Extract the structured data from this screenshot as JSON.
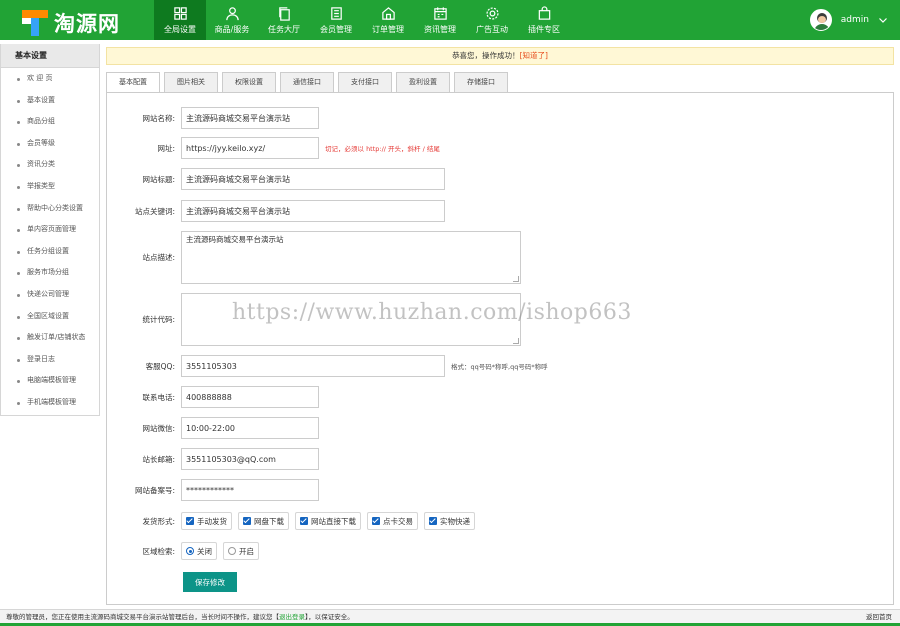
{
  "brand": {
    "logo_text": "淘源网"
  },
  "nav": [
    {
      "label": "全局设置",
      "icon": "grid-icon",
      "active": true
    },
    {
      "label": "商品/服务",
      "icon": "user-icon"
    },
    {
      "label": "任务大厅",
      "icon": "copy-icon"
    },
    {
      "label": "会员管理",
      "icon": "document-icon"
    },
    {
      "label": "订单管理",
      "icon": "home-icon"
    },
    {
      "label": "资讯管理",
      "icon": "calendar-icon"
    },
    {
      "label": "广告互动",
      "icon": "gear-icon"
    },
    {
      "label": "插件专区",
      "icon": "bag-icon"
    }
  ],
  "user": {
    "name": "admin"
  },
  "sidebar": {
    "title": "基本设置",
    "items": [
      {
        "label": "欢 迎 页"
      },
      {
        "label": "基本设置"
      },
      {
        "label": "商品分组"
      },
      {
        "label": "会员等级"
      },
      {
        "label": "资讯分类"
      },
      {
        "label": "举报类型"
      },
      {
        "label": "帮助中心分类设置"
      },
      {
        "label": "单内容页面管理"
      },
      {
        "label": "任务分组设置"
      },
      {
        "label": "服务市场分组"
      },
      {
        "label": "快递公司管理"
      },
      {
        "label": "全国区域设置"
      },
      {
        "label": "触发订单/店铺状态"
      },
      {
        "label": "登录日志"
      },
      {
        "label": "电脑端模板管理"
      },
      {
        "label": "手机端模板管理"
      }
    ]
  },
  "message": {
    "text": "恭喜您，操作成功！",
    "link": "[知道了]"
  },
  "tabs": [
    {
      "label": "基本配置",
      "active": true
    },
    {
      "label": "图片相关"
    },
    {
      "label": "权限设置"
    },
    {
      "label": "通信接口"
    },
    {
      "label": "支付接口"
    },
    {
      "label": "盈利设置"
    },
    {
      "label": "存储接口"
    }
  ],
  "form": {
    "site_name": {
      "label": "网站名称:",
      "value": "主流源码商城交易平台演示站"
    },
    "site_url": {
      "label": "网址:",
      "value": "https://jyy.keilo.xyz/",
      "hint": "切记，必须以 http:// 开头，斜杆 / 结尾"
    },
    "site_title": {
      "label": "网站标题:",
      "value": "主流源码商城交易平台演示站"
    },
    "keywords": {
      "label": "站点关键词:",
      "value": "主流源码商城交易平台演示站"
    },
    "description": {
      "label": "站点描述:",
      "value": "主流源码商城交易平台演示站"
    },
    "stats_code": {
      "label": "统计代码:",
      "value": ""
    },
    "qq": {
      "label": "客服QQ:",
      "value": "3551105303",
      "hint": "格式：qq号码*称呼,qq号码*称呼"
    },
    "phone": {
      "label": "联系电话:",
      "value": "400888888"
    },
    "wechat": {
      "label": "网站微信:",
      "value": "10:00-22:00"
    },
    "email": {
      "label": "站长邮箱:",
      "value": "3551105303@qQ.com"
    },
    "icp": {
      "label": "网站备案号:",
      "value": "************"
    },
    "shipping": {
      "label": "发货形式:",
      "options": [
        {
          "label": "手动发货",
          "checked": true
        },
        {
          "label": "网盘下载",
          "checked": true
        },
        {
          "label": "网站直接下载",
          "checked": true
        },
        {
          "label": "点卡交易",
          "checked": true
        },
        {
          "label": "实物快递",
          "checked": true
        }
      ]
    },
    "region_search": {
      "label": "区域检索:",
      "options": [
        {
          "label": "关闭",
          "selected": true
        },
        {
          "label": "开启",
          "selected": false
        }
      ]
    },
    "save_label": "保存修改"
  },
  "watermark": "https://www.huzhan.com/ishop663",
  "status": {
    "text": "尊敬的管理员，您正在使用主流源码商城交易平台演示站管理后台，当长时间不操作，建议您【",
    "link": "退出登录",
    "text_after": "】，以保证安全。",
    "home": "返回首页"
  },
  "colors": {
    "brand_green": "#21a335",
    "active_nav": "#0e7a1f",
    "save_button": "#0d9488",
    "checkbox_blue": "#1565c0",
    "hint_red": "#e53935"
  }
}
